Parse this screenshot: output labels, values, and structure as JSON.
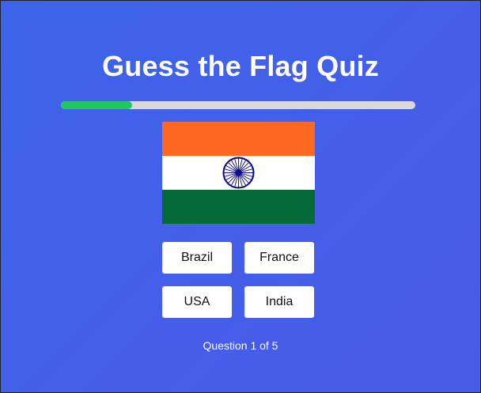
{
  "quiz": {
    "title": "Guess the Flag Quiz",
    "progress_fraction": 0.2,
    "flag": {
      "icon": "india-flag-icon",
      "colors": {
        "saffron": "#ff6820",
        "white": "#ffffff",
        "green": "#046a38",
        "chakra": "#06038d"
      }
    },
    "answers": [
      "Brazil",
      "France",
      "USA",
      "India"
    ],
    "question_counter": "Question 1 of 5"
  },
  "colors": {
    "background": "#4060ea",
    "progress_fill": "#22c55e",
    "progress_track": "#d9d9d9",
    "button_bg": "#ffffff"
  }
}
